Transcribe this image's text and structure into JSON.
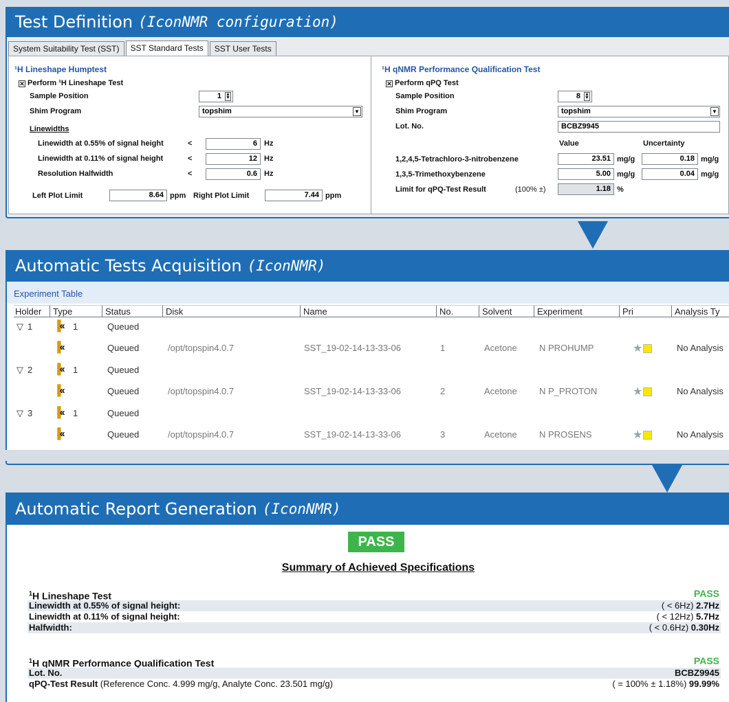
{
  "panel1": {
    "title": "Test Definition",
    "subtitle": "(IconNMR configuration)",
    "tabs": [
      "System Suitability Test (SST)",
      "SST Standard Tests",
      "SST User Tests"
    ],
    "left": {
      "section": "¹H Lineshape Humptest",
      "perform": "Perform ¹H Lineshape Test",
      "sample_position_label": "Sample Position",
      "sample_position": "1",
      "shim_label": "Shim Program",
      "shim": "topshim",
      "linewidths_label": "Linewidths",
      "lw055_label": "Linewidth at 0.55% of signal height",
      "lw055_op": "<",
      "lw055": "6",
      "lw011_label": "Linewidth at 0.11% of signal height",
      "lw011_op": "<",
      "lw011": "12",
      "halfwidth_label": "Resolution Halfwidth",
      "halfwidth_op": "<",
      "halfwidth": "0.6",
      "unit_hz": "Hz",
      "left_plot_label": "Left Plot Limit",
      "left_plot": "8.64",
      "right_plot_label": "Right Plot Limit",
      "right_plot": "7.44",
      "unit_ppm": "ppm"
    },
    "right": {
      "section": "¹H qNMR Performance Qualification Test",
      "perform": "Perform qPQ Test",
      "sample_position_label": "Sample Position",
      "sample_position": "8",
      "shim_label": "Shim Program",
      "shim": "topshim",
      "lot_label": "Lot. No.",
      "lot": "BCBZ9945",
      "value_head": "Value",
      "uncert_head": "Uncertainty",
      "cmp1_label": "1,2,4,5-Tetrachloro-3-nitrobenzene",
      "cmp1_value": "23.51",
      "cmp1_uncert": "0.18",
      "cmp2_label": "1,3,5-Trimethoxybenzene",
      "cmp2_value": "5.00",
      "cmp2_uncert": "0.04",
      "unit_mgg": "mg/g",
      "limit_label": "Limit for qPQ-Test Result",
      "limit_paren": "(100% ±)",
      "limit": "1.18",
      "unit_pct": "%"
    }
  },
  "panel2": {
    "title": "Automatic Tests Acquisition",
    "subtitle": "(IconNMR)",
    "table_title": "Experiment Table",
    "columns": [
      "Holder",
      "Type",
      "Status",
      "Disk",
      "Name",
      "No.",
      "Solvent",
      "Experiment",
      "Pri",
      "Analysis Ty"
    ],
    "rows": [
      {
        "holder": "1",
        "count": "1",
        "status": "Queued"
      },
      {
        "status": "Queued",
        "disk": "/opt/topspin4.0.7",
        "name": "SST_19-02-14-13-33-06",
        "no": "1",
        "solvent": "Acetone",
        "experiment": "N PROHUMP",
        "analysis": "No Analysis"
      },
      {
        "holder": "2",
        "count": "1",
        "status": "Queued"
      },
      {
        "status": "Queued",
        "disk": "/opt/topspin4.0.7",
        "name": "SST_19-02-14-13-33-06",
        "no": "2",
        "solvent": "Acetone",
        "experiment": "N P_PROTON",
        "analysis": "No Analysis"
      },
      {
        "holder": "3",
        "count": "1",
        "status": "Queued"
      },
      {
        "status": "Queued",
        "disk": "/opt/topspin4.0.7",
        "name": "SST_19-02-14-13-33-06",
        "no": "3",
        "solvent": "Acetone",
        "experiment": "N PROSENS",
        "analysis": "No Analysis"
      }
    ]
  },
  "panel3": {
    "title": "Automatic Report Generation",
    "subtitle": "(IconNMR)",
    "badge": "PASS",
    "summary_title": "Summary of Achieved Specifications",
    "lineshape": {
      "sup": "1",
      "heading": "H Lineshape Test",
      "result": "PASS",
      "r1_label": "Linewidth at 0.55% of signal height:",
      "r1_spec": "( < 6Hz)",
      "r1_val": "2.7Hz",
      "r2_label": "Linewidth at 0.11% of signal height:",
      "r2_spec": "( < 12Hz)",
      "r2_val": "5.7Hz",
      "r3_label": "Halfwidth:",
      "r3_spec": "( < 0.6Hz)",
      "r3_val": "0.30Hz"
    },
    "qnmr": {
      "sup": "1",
      "heading": "H qNMR Performance Qualification Test",
      "result": "PASS",
      "lot_label": "Lot. No.",
      "lot": "BCBZ9945",
      "qpq_label": "qPQ-Test Result",
      "qpq_detail": "(Reference Conc. 4.999 mg/g, Analyte Conc. 23.501 mg/g)",
      "qpq_spec": "( = 100% ± 1.18%)",
      "qpq_val": "99.99%"
    }
  },
  "colors": {
    "header_blue": "#1f6eb5",
    "pass_green": "#3cb54a",
    "section_blue": "#2355a5",
    "pri_yellow": "#ffe600"
  }
}
